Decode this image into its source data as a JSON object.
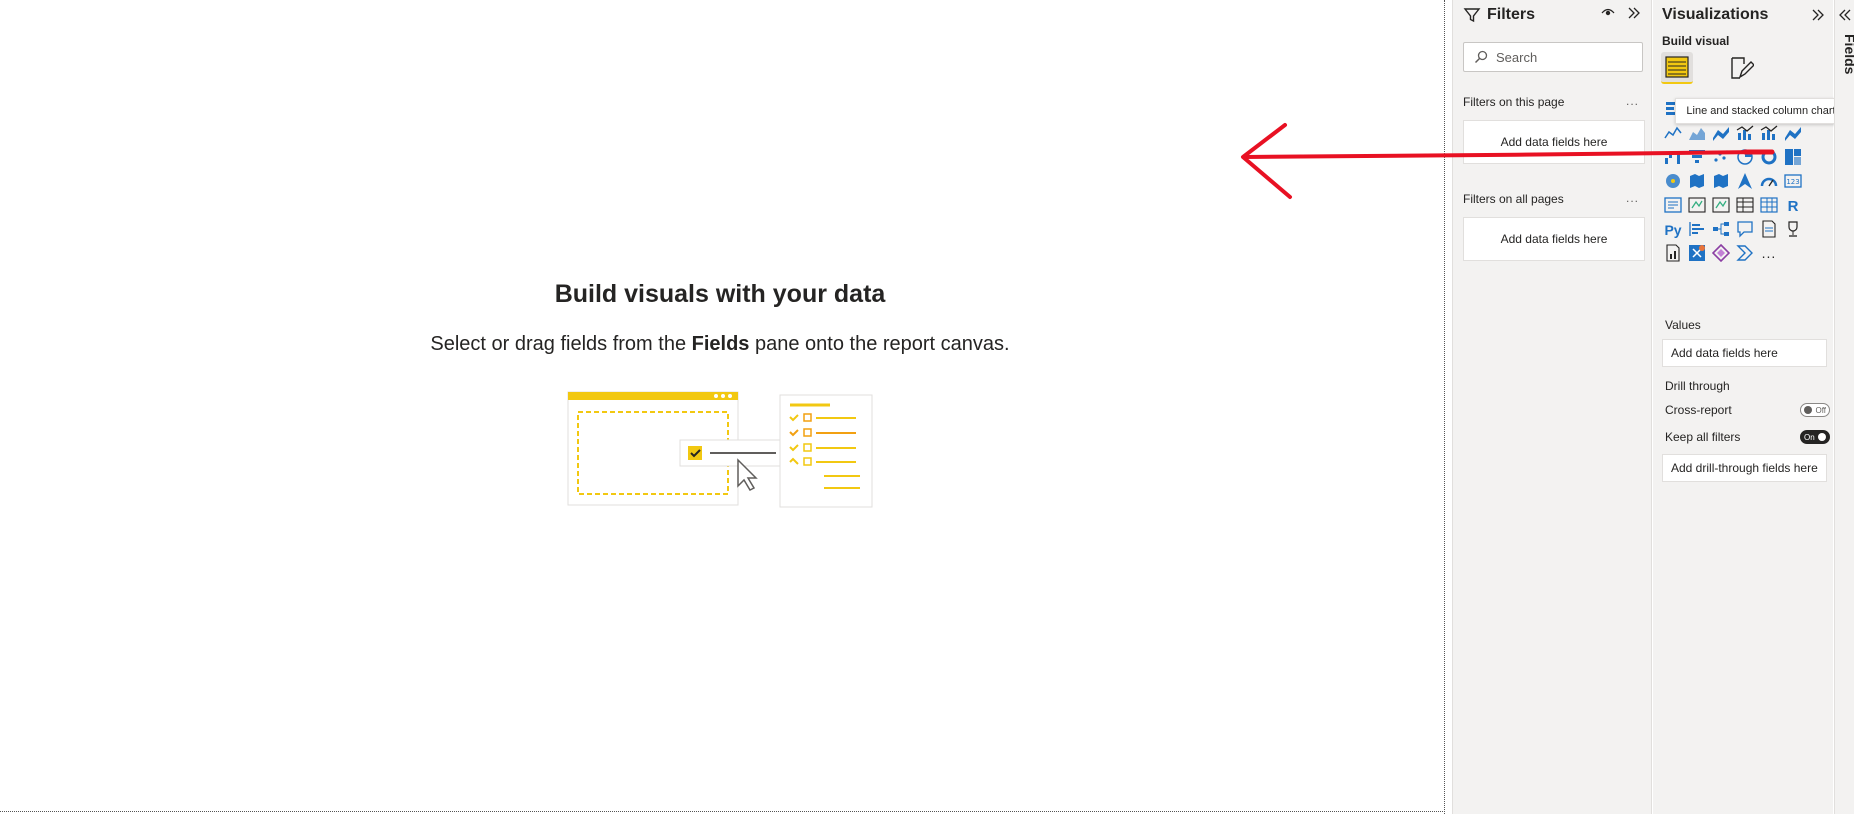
{
  "canvas": {
    "empty_title": "Build visuals with your data",
    "empty_sub_prefix": "Select or drag fields from the ",
    "empty_sub_bold": "Fields",
    "empty_sub_suffix": " pane onto the report canvas."
  },
  "filters": {
    "title": "Filters",
    "search_placeholder": "Search",
    "this_page_label": "Filters on this page",
    "this_page_drop": "Add data fields here",
    "all_pages_label": "Filters on all pages",
    "all_pages_drop": "Add data fields here",
    "more": "..."
  },
  "visualizations": {
    "title": "Visualizations",
    "build_visual": "Build visual",
    "tooltip": "Line and stacked column chart",
    "values_label": "Values",
    "values_drop": "Add data fields here",
    "drill_label": "Drill through",
    "cross_report_label": "Cross-report",
    "cross_report_state": "Off",
    "keep_filters_label": "Keep all filters",
    "keep_filters_state": "On",
    "drill_drop": "Add drill-through fields here",
    "r_label": "R",
    "py_label": "Py",
    "more_visuals": "...",
    "card_label": "123"
  },
  "fields": {
    "title": "Fields"
  },
  "colors": {
    "accent": "#f2c811",
    "viz_blue": "#1f72c4",
    "annotation": "#e81123"
  }
}
